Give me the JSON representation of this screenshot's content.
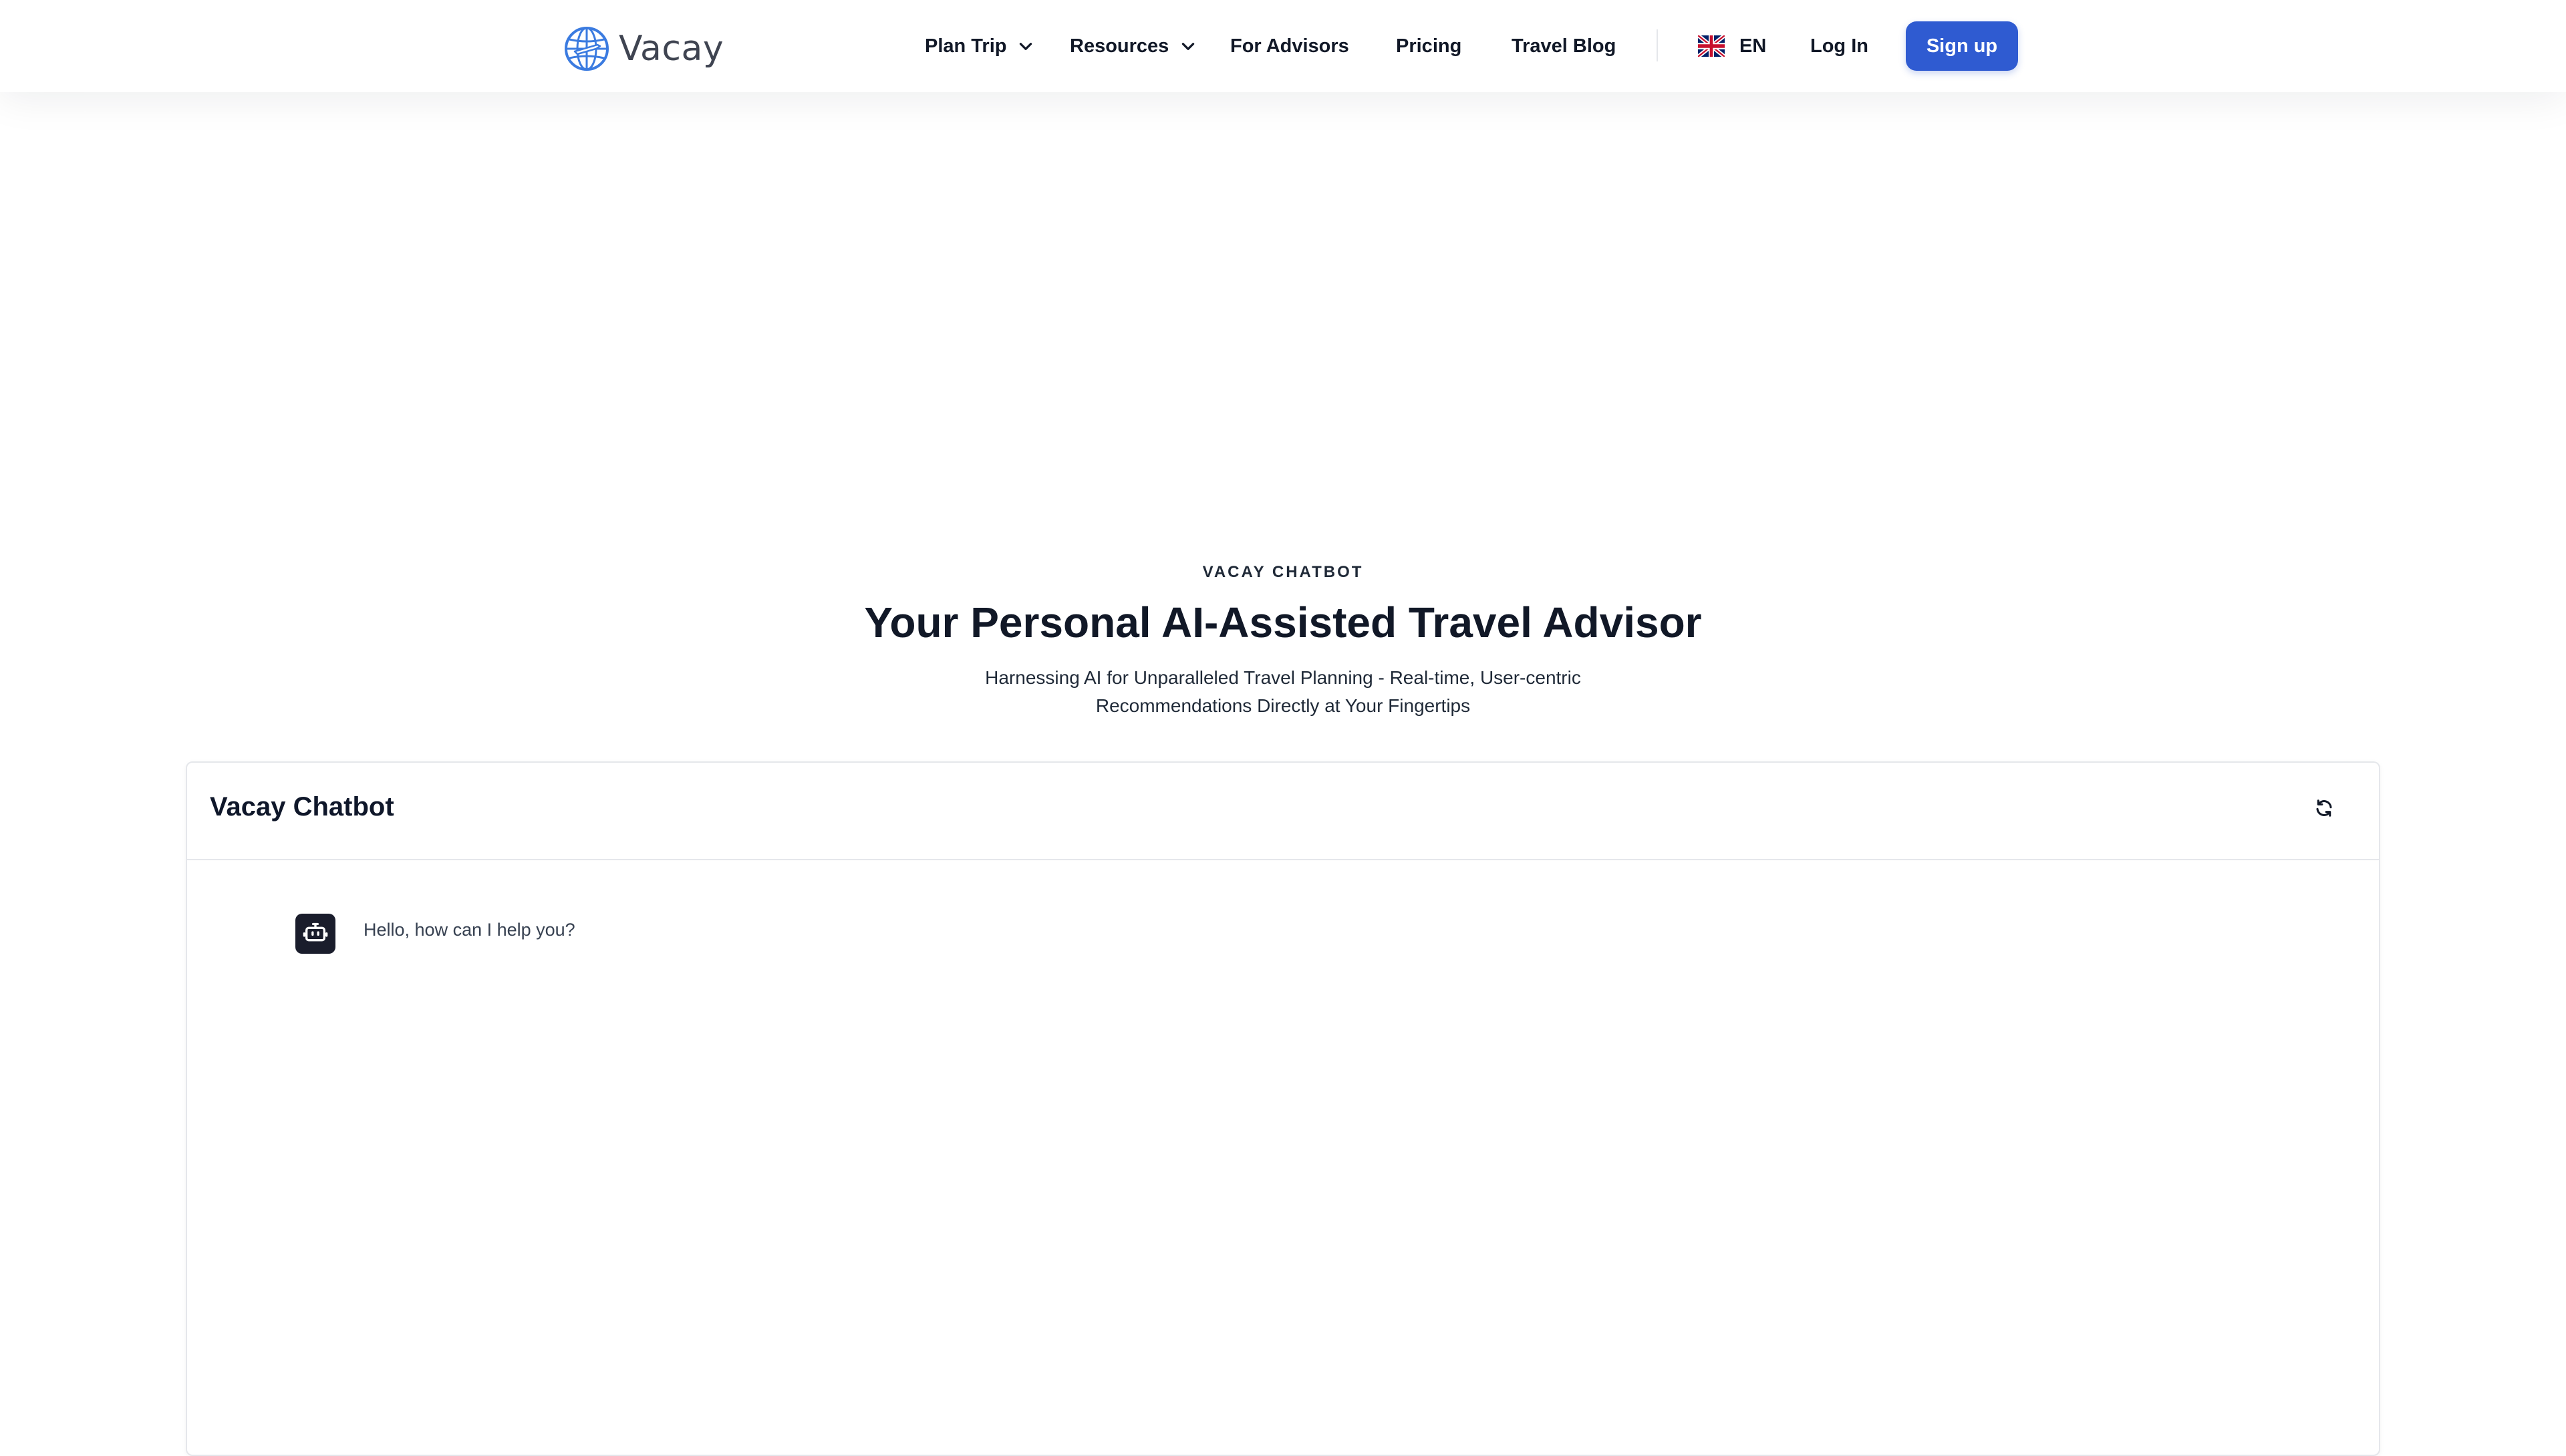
{
  "header": {
    "logo_text": "Vacay",
    "nav": {
      "plan_trip": "Plan Trip",
      "resources": "Resources",
      "for_advisors": "For Advisors",
      "pricing": "Pricing",
      "travel_blog": "Travel Blog"
    },
    "language": "EN",
    "login": "Log In",
    "signup": "Sign up"
  },
  "hero": {
    "eyebrow": "VACAY CHATBOT",
    "title": "Your Personal AI-Assisted Travel Advisor",
    "subtitle_line1": "Harnessing AI for Unparalleled Travel Planning - Real-time, User-centric",
    "subtitle_line2": "Recommendations Directly at Your Fingertips"
  },
  "chat": {
    "title": "Vacay Chatbot",
    "messages": [
      {
        "role": "bot",
        "text": "Hello, how can I help you?"
      }
    ]
  },
  "icons": {
    "logo": "globe-plane-icon",
    "dropdown": "chevron-down-icon",
    "language": "uk-flag-icon",
    "refresh": "refresh-icon",
    "bot": "robot-icon"
  },
  "colors": {
    "brand_blue": "#2f5bd1",
    "logo_blue": "#3b7be0",
    "text_dark": "#111827",
    "bot_avatar_bg": "#1a1d2c",
    "border": "#e5e7eb"
  }
}
